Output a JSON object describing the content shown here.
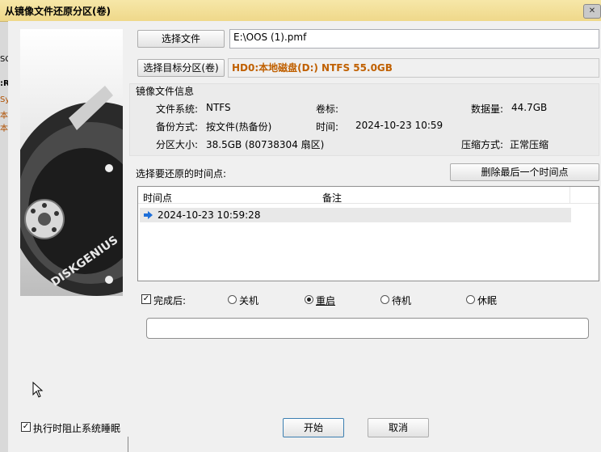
{
  "window": {
    "title": "从镜像文件还原分区(卷)",
    "close_glyph": "✕"
  },
  "background_fragments": {
    "a": "SC",
    "b": ":R",
    "c": "Sys",
    "d": "本",
    "e": "本"
  },
  "source": {
    "choose_file_label": "选择文件",
    "file_path": "E:\\OOS (1).pmf",
    "choose_target_label": "选择目标分区(卷)",
    "target_value": "HD0:本地磁盘(D:) NTFS 55.0GB"
  },
  "image_info": {
    "group_title": "镜像文件信息",
    "fs_label": "文件系统:",
    "fs_value": "NTFS",
    "volume_label": "卷标:",
    "volume_value": "",
    "data_label": "数据量:",
    "data_value": "44.7GB",
    "backup_label": "备份方式:",
    "backup_value": "按文件(热备份)",
    "time_label": "时间:",
    "time_value": "2024-10-23 10:59",
    "size_label": "分区大小:",
    "size_value": "38.5GB (80738304 扇区)",
    "compress_label": "压缩方式:",
    "compress_value": "正常压缩"
  },
  "timepoints": {
    "section_label": "选择要还原的时间点:",
    "delete_last_label": "删除最后一个时间点",
    "col_time": "时间点",
    "col_note": "备注",
    "rows": [
      {
        "time": "2024-10-23 10:59:28",
        "note": ""
      }
    ]
  },
  "after": {
    "checkbox_label": "完成后:",
    "checked_glyph": "✓",
    "options": [
      "关机",
      "重启",
      "待机",
      "休眠"
    ],
    "selected": "重启"
  },
  "footer": {
    "prevent_sleep_label": "执行时阻止系统睡眠",
    "start_label": "开始",
    "cancel_label": "取消"
  },
  "art": {
    "brand_text": "DISKGENIUS"
  },
  "colors": {
    "accent_orange": "#c06000",
    "arrow_blue": "#1e6fd9"
  }
}
